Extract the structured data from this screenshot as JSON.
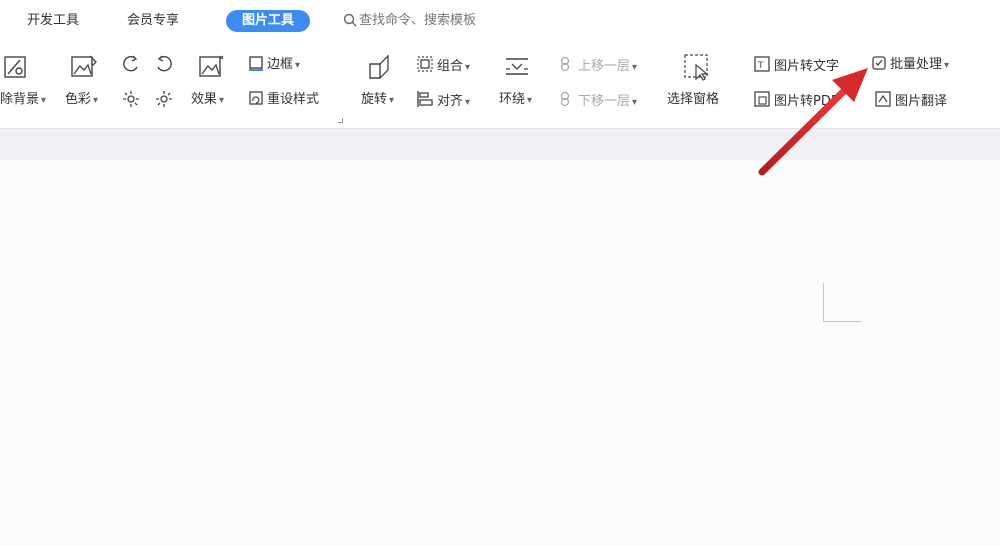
{
  "tabs": {
    "dev_tools": "开发工具",
    "member": "会员专享",
    "picture_tools": "图片工具"
  },
  "search": {
    "placeholder": "查找命令、搜索模板"
  },
  "ribbon": {
    "remove_bg": "除背景",
    "color": "色彩",
    "effect": "效果",
    "border": "边框",
    "reset_style": "重设样式",
    "rotate": "旋转",
    "group": "组合",
    "align": "对齐",
    "wrap": "环绕",
    "bring_forward": "上移一层",
    "send_backward": "下移一层",
    "selection_pane": "选择窗格",
    "pic_to_text": "图片转文字",
    "pic_to_pdf": "图片转PDF",
    "batch_process": "批量处理",
    "pic_translate": "图片翻译"
  },
  "colors": {
    "accent": "#3f8cf0",
    "arrow": "#d62a2a"
  }
}
